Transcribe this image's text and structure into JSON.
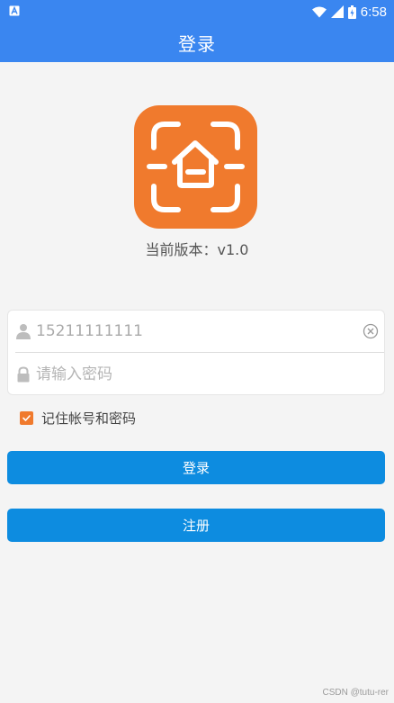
{
  "status_bar": {
    "time": "6:58",
    "icons": [
      "notification-icon",
      "wifi-icon",
      "signal-icon",
      "battery-icon"
    ]
  },
  "app_bar": {
    "title": "登录"
  },
  "logo": {
    "icon": "house-scan-icon",
    "color": "#f07a2d"
  },
  "version_text": "当前版本：v1.0",
  "form": {
    "username": {
      "value": "15211111111",
      "icon": "user-icon"
    },
    "password": {
      "placeholder": "请输入密码",
      "value": "",
      "icon": "lock-icon"
    },
    "remember": {
      "label": "记住帐号和密码",
      "checked": true
    }
  },
  "buttons": {
    "login": "登录",
    "register": "注册"
  },
  "watermark": "CSDN @tutu-rer",
  "colors": {
    "primary": "#3a86f0",
    "button": "#0d8ce0",
    "accent": "#f07a2d"
  }
}
